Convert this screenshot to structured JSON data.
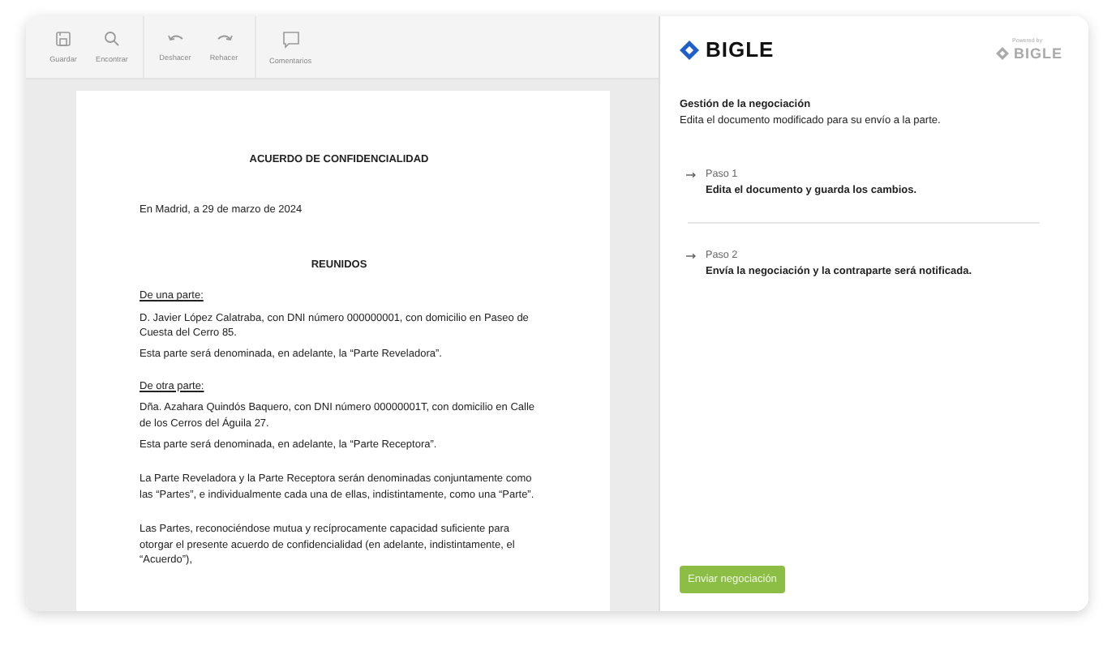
{
  "toolbar": {
    "groups": [
      [
        {
          "kind": "save",
          "label": "Guardar"
        },
        {
          "kind": "search",
          "label": "Encontrar"
        }
      ],
      [
        {
          "kind": "undo",
          "label": "Deshacer"
        },
        {
          "kind": "redo",
          "label": "Rehacer"
        }
      ],
      [
        {
          "kind": "comment",
          "label": "Comentarios"
        }
      ]
    ]
  },
  "document": {
    "blocks": [
      {
        "kind": "title",
        "text": "ACUERDO DE CONFIDENCIALIDAD"
      },
      {
        "kind": "text",
        "text": "En Madrid, a 29 de marzo de 2024"
      },
      {
        "kind": "heading",
        "text": "REUNIDOS"
      },
      {
        "kind": "label",
        "text": "De una parte:"
      },
      {
        "kind": "line",
        "text": "D. Javier López Calatraba, con DNI número 000000001, con domicilio en Paseo de Cuesta del Cerro 85."
      },
      {
        "kind": "line",
        "text": "Esta parte será denominada, en adelante, la “Parte Reveladora”."
      },
      {
        "kind": "label",
        "text": "De otra parte:"
      },
      {
        "kind": "line",
        "text": "Dña. Azahara Quindós Baquero, con DNI número 00000001T, con domicilio en Calle de los Cerros del Águila 27."
      },
      {
        "kind": "line",
        "text": "Esta parte será denominada, en adelante, la “Parte Receptora”."
      },
      {
        "kind": "text",
        "text": "La Parte Reveladora y la Parte Receptora serán denominadas conjuntamente como las “Partes”, e individualmente cada una de ellas, indistintamente, como una “Parte”."
      },
      {
        "kind": "text",
        "text": "Las Partes, reconociéndose mutua y recíprocamente capacidad suficiente para otorgar el presente acuerdo de confidencialidad (en adelante, indistintamente, el “Acuerdo”),"
      }
    ]
  },
  "panel": {
    "logo": "BIGLE",
    "powered_by": "Powered by",
    "powered_logo": "BIGLE",
    "title": "Gestión de la negociación",
    "subtitle": "Edita el documento modificado para su envío a la parte.",
    "steps": [
      {
        "label": "Paso 1",
        "text": "Edita el documento y guarda los cambios."
      },
      {
        "label": "Paso 2",
        "text": "Envía la negociación y la contraparte será notificada."
      }
    ],
    "button": "Enviar negociación"
  }
}
